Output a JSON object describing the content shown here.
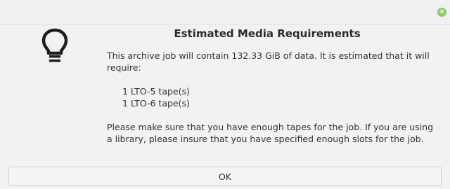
{
  "dialog": {
    "title": "Estimated Media Requirements",
    "intro": "This archive job will contain 132.33 GiB of data.  It is estimated that it will require:",
    "tapes": [
      "1 LTO-5 tape(s)",
      "1 LTO-6 tape(s)"
    ],
    "note": "Please make sure that you have enough tapes for the job.  If you are using a library, please insure that you have specified enough slots for the job.",
    "ok_label": "OK"
  },
  "titlebar": {
    "close_glyph": "×"
  },
  "icons": {
    "dialog_icon": "lightbulb-icon",
    "close_icon": "close-icon"
  },
  "colors": {
    "close_button": "#8ecf6b",
    "background": "#f2f2f2"
  }
}
